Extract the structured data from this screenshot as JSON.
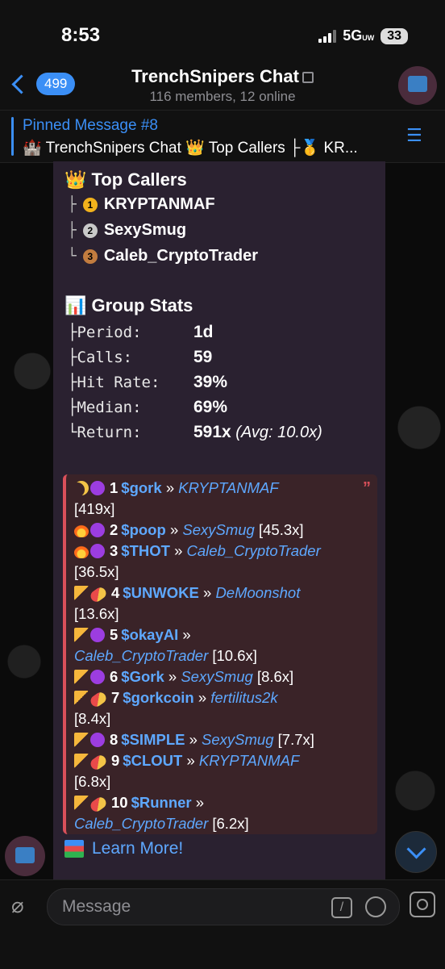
{
  "status": {
    "time": "8:53",
    "network": "5G",
    "network_sub": "UW",
    "battery": "33"
  },
  "header": {
    "back_count": "499",
    "title": "TrenchSnipers Chat",
    "subtitle": "116 members, 12 online"
  },
  "pinned": {
    "title": "Pinned Message #8",
    "preview": "🏰 TrenchSnipers Chat 👑 Top Callers ├🥇 KR..."
  },
  "message": {
    "top_callers_title": "👑 Top Callers",
    "top_callers": [
      {
        "branch": "├",
        "medal": "1",
        "name": "KRYPTANMAF"
      },
      {
        "branch": "├",
        "medal": "2",
        "name": "SexySmug"
      },
      {
        "branch": "└",
        "medal": "3",
        "name": "Caleb_CryptoTrader"
      }
    ],
    "stats_title": "📊 Group Stats",
    "stats": [
      {
        "label": "├Period:",
        "value": "1d"
      },
      {
        "label": "├Calls:",
        "value": "59"
      },
      {
        "label": "├Hit Rate:",
        "value": "39%"
      },
      {
        "label": "├Median:",
        "value": "69%"
      },
      {
        "label": "└Return:",
        "value": "591x",
        "extra": "(Avg: 10.0x)"
      }
    ],
    "calls": [
      {
        "rank": "1",
        "ticker": "$gork",
        "sep": "»",
        "user": "KRYPTANMAF",
        "mult": "[419x]"
      },
      {
        "rank": "2",
        "ticker": "$poop",
        "sep": "»",
        "user": "SexySmug",
        "mult": "[45.3x]"
      },
      {
        "rank": "3",
        "ticker": "$THOT",
        "sep": "»",
        "user": "Caleb_CryptoTrader",
        "mult": "[36.5x]"
      },
      {
        "rank": "4",
        "ticker": "$UNWOKE",
        "sep": "»",
        "user": "DeMoonshot",
        "mult": "[13.6x]"
      },
      {
        "rank": "5",
        "ticker": "$okayAI",
        "sep": "»",
        "user": "Caleb_CryptoTrader",
        "mult": "[10.6x]"
      },
      {
        "rank": "6",
        "ticker": "$Gork",
        "sep": "»",
        "user": "SexySmug",
        "mult": "[8.6x]"
      },
      {
        "rank": "7",
        "ticker": "$gorkcoin",
        "sep": "»",
        "user": "fertilitus2k",
        "mult": "[8.4x]"
      },
      {
        "rank": "8",
        "ticker": "$SIMPLE",
        "sep": "»",
        "user": "SexySmug",
        "mult": "[7.7x]"
      },
      {
        "rank": "9",
        "ticker": "$CLOUT",
        "sep": "»",
        "user": "KRYPTANMAF",
        "mult": "[6.8x]"
      },
      {
        "rank": "10",
        "ticker": "$Runner",
        "sep": "»",
        "user": "Caleb_CryptoTrader",
        "mult": "[6.2x]"
      }
    ],
    "learn_more": "Learn More!"
  },
  "input": {
    "placeholder": "Message"
  },
  "colors": {
    "accent": "#3b8ff6",
    "link": "#5ea8ff",
    "quote_bar": "#d9505a",
    "bubble": "#2a2130"
  }
}
